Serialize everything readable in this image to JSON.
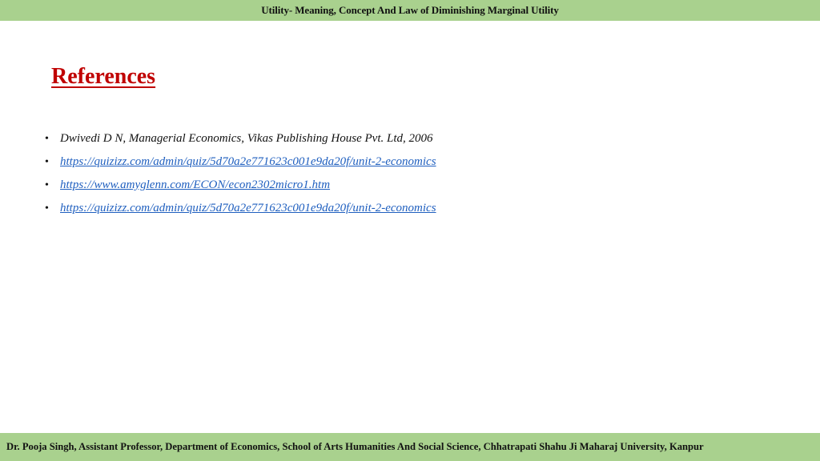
{
  "header": {
    "title": "Utility- Meaning, Concept And Law of Diminishing Marginal Utility"
  },
  "slide": {
    "heading": "References",
    "references": [
      {
        "bullet": "•",
        "text": "Dwivedi D N, Managerial Economics, Vikas Publishing House Pvt. Ltd, 2006",
        "is_link": false
      },
      {
        "bullet": "•",
        "text": "https://quizizz.com/admin/quiz/5d70a2e771623c001e9da20f/unit-2-economics",
        "is_link": true
      },
      {
        "bullet": "•",
        "text": "https://www.amyglenn.com/ECON/econ2302micro1.htm",
        "is_link": true
      },
      {
        "bullet": "•",
        "text": "https://quizizz.com/admin/quiz/5d70a2e771623c001e9da20f/unit-2-economics",
        "is_link": true
      }
    ]
  },
  "footer": {
    "text": "Dr. Pooja Singh, Assistant Professor, Department of Economics, School of Arts Humanities And Social Science, Chhatrapati Shahu Ji Maharaj University, Kanpur"
  },
  "colors": {
    "band": "#a9d18e",
    "heading": "#c00000",
    "link": "#1f5fbf"
  }
}
